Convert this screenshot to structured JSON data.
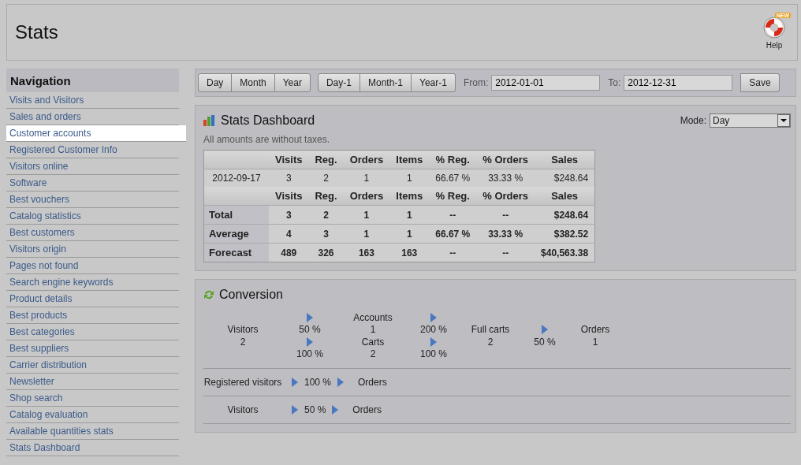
{
  "header": {
    "title": "Stats",
    "help": {
      "label": "Help",
      "badge": "NEW"
    }
  },
  "sidebar": {
    "title": "Navigation",
    "items": [
      {
        "label": "Visits and Visitors",
        "selected": false
      },
      {
        "label": "Sales and orders",
        "selected": false
      },
      {
        "label": "Customer accounts",
        "selected": true
      },
      {
        "label": "Registered Customer Info",
        "selected": false
      },
      {
        "label": "Visitors online",
        "selected": false
      },
      {
        "label": "Software",
        "selected": false
      },
      {
        "label": "Best vouchers",
        "selected": false
      },
      {
        "label": "Catalog statistics",
        "selected": false
      },
      {
        "label": "Best customers",
        "selected": false
      },
      {
        "label": "Visitors origin",
        "selected": false
      },
      {
        "label": "Pages not found",
        "selected": false
      },
      {
        "label": "Search engine keywords",
        "selected": false
      },
      {
        "label": "Product details",
        "selected": false
      },
      {
        "label": "Best products",
        "selected": false
      },
      {
        "label": "Best categories",
        "selected": false
      },
      {
        "label": "Best suppliers",
        "selected": false
      },
      {
        "label": "Carrier distribution",
        "selected": false
      },
      {
        "label": "Newsletter",
        "selected": false
      },
      {
        "label": "Shop search",
        "selected": false
      },
      {
        "label": "Catalog evaluation",
        "selected": false
      },
      {
        "label": "Available quantities stats",
        "selected": false
      },
      {
        "label": "Stats Dashboard",
        "selected": false
      }
    ]
  },
  "toolbar": {
    "groups": [
      [
        "Day",
        "Month",
        "Year"
      ],
      [
        "Day-1",
        "Month-1",
        "Year-1"
      ]
    ],
    "from_label": "From:",
    "from_value": "2012-01-01",
    "to_label": "To:",
    "to_value": "2012-12-31",
    "save": "Save"
  },
  "dashboard": {
    "title": "Stats Dashboard",
    "mode_label": "Mode:",
    "mode_value": "Day",
    "note": "All amounts are without taxes.",
    "columns": [
      "Visits",
      "Reg.",
      "Orders",
      "Items",
      "% Reg.",
      "% Orders",
      "Sales"
    ],
    "rows": [
      {
        "label": "2012-09-17",
        "cells": [
          "3",
          "2",
          "1",
          "1",
          "66.67 %",
          "33.33 %",
          "$248.64"
        ]
      }
    ],
    "summary_columns": [
      "Visits",
      "Reg.",
      "Orders",
      "Items",
      "% Reg.",
      "% Orders",
      "Sales"
    ],
    "summary": [
      {
        "label": "Total",
        "cells": [
          "3",
          "2",
          "1",
          "1",
          "--",
          "--",
          "$248.64"
        ]
      },
      {
        "label": "Average",
        "cells": [
          "4",
          "3",
          "1",
          "1",
          "66.67 %",
          "33.33 %",
          "$382.52"
        ]
      },
      {
        "label": "Forecast",
        "cells": [
          "489",
          "326",
          "163",
          "163",
          "--",
          "--",
          "$40,563.38"
        ]
      }
    ]
  },
  "conversion": {
    "title": "Conversion",
    "funnel": {
      "visitors": {
        "label": "Visitors",
        "value": "2"
      },
      "to_accounts": "50 %",
      "accounts": {
        "label": "Accounts",
        "value": "1"
      },
      "accounts_to_full": "200 %",
      "to_carts": "100 %",
      "carts": {
        "label": "Carts",
        "value": "2"
      },
      "carts_to_full": "100 %",
      "full_carts": {
        "label": "Full carts",
        "value": "2"
      },
      "full_to_orders": "50 %",
      "orders": {
        "label": "Orders",
        "value": "1"
      }
    },
    "rows": [
      {
        "label": "Registered visitors",
        "rate": "100 %",
        "target": "Orders"
      },
      {
        "label": "Visitors",
        "rate": "50 %",
        "target": "Orders"
      }
    ]
  }
}
